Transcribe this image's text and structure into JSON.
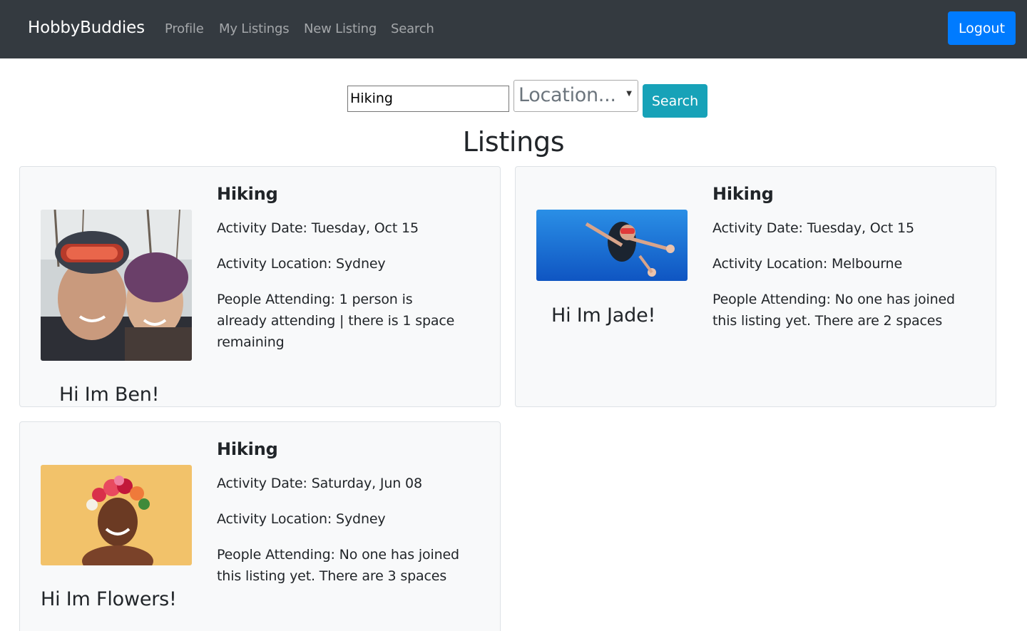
{
  "navbar": {
    "brand": "HobbyBuddies",
    "links": [
      "Profile",
      "My Listings",
      "New Listing",
      "Search"
    ],
    "logout_label": "Logout",
    "colors": {
      "background": "#343a40",
      "logout": "#007bff"
    }
  },
  "search": {
    "query_value": "Hiking",
    "location_placeholder": "Location...",
    "button_label": "Search",
    "button_color": "#17a2b8"
  },
  "page_title": "Listings",
  "listings": [
    {
      "greeting": "Hi Im Ben!",
      "photo_icon": "couple-snow-photo",
      "title": "Hiking",
      "date": "Activity Date: Tuesday, Oct 15",
      "location": "Activity Location: Sydney",
      "attending": "People Attending: 1 person is already attending | there is 1 space remaining"
    },
    {
      "greeting": "Hi Im Jade!",
      "photo_icon": "scuba-diver-photo",
      "title": "Hiking",
      "date": "Activity Date: Tuesday, Oct 15",
      "location": "Activity Location: Melbourne",
      "attending": "People Attending: No one has joined this listing yet. There are 2 spaces"
    },
    {
      "greeting": "Hi Im Flowers!",
      "photo_icon": "flower-crown-photo",
      "title": "Hiking",
      "date": "Activity Date: Saturday, Jun 08",
      "location": "Activity Location: Sydney",
      "attending": "People Attending: No one has joined this listing yet. There are 3 spaces"
    }
  ]
}
